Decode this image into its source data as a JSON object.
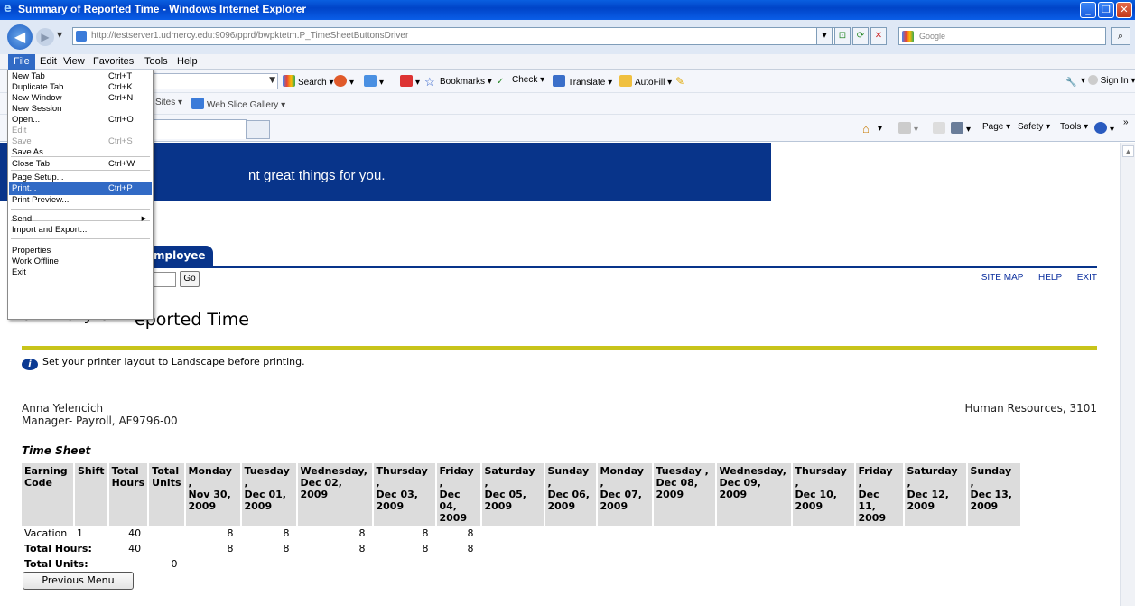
{
  "window": {
    "title": "Summary of Reported Time - Windows Internet Explorer",
    "url": "http://testserver1.udmercy.edu:9096/pprd/bwpktetm.P_TimeSheetButtonsDriver",
    "search_placeholder": "Google"
  },
  "menubar": {
    "items": [
      "File",
      "Edit",
      "View",
      "Favorites",
      "Tools",
      "Help"
    ]
  },
  "toolbar": {
    "search": "Search",
    "bookmarks": "Bookmarks",
    "check": "Check",
    "translate": "Translate",
    "autofill": "AutoFill",
    "sign_in": "Sign In",
    "favorites_partial": "Sites",
    "web_slice_gallery": "Web Slice Gallery",
    "page": "Page",
    "safety": "Safety",
    "tools": "Tools"
  },
  "file_menu": {
    "items": [
      {
        "label": "New Tab",
        "shortcut": "Ctrl+T"
      },
      {
        "label": "Duplicate Tab",
        "shortcut": "Ctrl+K"
      },
      {
        "label": "New Window",
        "shortcut": "Ctrl+N"
      },
      {
        "label": "New Session",
        "shortcut": ""
      },
      {
        "label": "Open...",
        "shortcut": "Ctrl+O"
      },
      {
        "label": "Edit",
        "shortcut": ""
      },
      {
        "label": "Save",
        "shortcut": "Ctrl+S"
      },
      {
        "label": "Save As...",
        "shortcut": ""
      },
      {
        "label": "Close Tab",
        "shortcut": "Ctrl+W"
      },
      {
        "label": "Page Setup...",
        "shortcut": ""
      },
      {
        "label": "Print...",
        "shortcut": "Ctrl+P"
      },
      {
        "label": "Print Preview...",
        "shortcut": ""
      },
      {
        "label": "Send",
        "shortcut": ""
      },
      {
        "label": "Import and Export...",
        "shortcut": ""
      },
      {
        "label": "Properties",
        "shortcut": ""
      },
      {
        "label": "Work Offline",
        "shortcut": ""
      },
      {
        "label": "Exit",
        "shortcut": ""
      }
    ]
  },
  "page": {
    "banner_slogan": "nt great things for you.",
    "employee_tab": "mployee",
    "go_label": "Go",
    "links": {
      "site_map": "SITE MAP",
      "help": "HELP",
      "exit": "EXIT"
    },
    "title": "Summary of Reported Time",
    "title_visible": "eported Time",
    "title_partial": "ummary of",
    "info_text": "Set your printer layout to Landscape before printing.",
    "employee_name": "Anna Yelencich",
    "employee_position": "Manager- Payroll, AF9796-00",
    "department": "Human Resources, 3101",
    "timesheet_title": "Time Sheet",
    "previous_menu": "Previous Menu"
  },
  "timesheet": {
    "headers": [
      [
        "Earning",
        "Code"
      ],
      [
        "Shift"
      ],
      [
        "Total",
        "Hours"
      ],
      [
        "Total",
        "Units"
      ],
      [
        "Monday ,",
        "Nov 30,",
        "2009"
      ],
      [
        "Tuesday ,",
        "Dec 01,",
        "2009"
      ],
      [
        "Wednesday,",
        "Dec 02,",
        "2009"
      ],
      [
        "Thursday ,",
        "Dec 03,",
        "2009"
      ],
      [
        "Friday ,",
        "Dec 04,",
        "2009"
      ],
      [
        "Saturday ,",
        "Dec 05,",
        "2009"
      ],
      [
        "Sunday ,",
        "Dec 06,",
        "2009"
      ],
      [
        "Monday ,",
        "Dec 07,",
        "2009"
      ],
      [
        "Tuesday ,",
        "Dec 08,",
        "2009"
      ],
      [
        "Wednesday,",
        "Dec 09,",
        "2009"
      ],
      [
        "Thursday ,",
        "Dec 10,",
        "2009"
      ],
      [
        "Friday ,",
        "Dec 11,",
        "2009"
      ],
      [
        "Saturday ,",
        "Dec 12,",
        "2009"
      ],
      [
        "Sunday ,",
        "Dec 13,",
        "2009"
      ]
    ],
    "rows": [
      {
        "code": "Vacation",
        "shift": "1",
        "total_hours": "40",
        "total_units": "",
        "days": [
          "8",
          "8",
          "8",
          "8",
          "8",
          "",
          "",
          "",
          "",
          "",
          "",
          "",
          "",
          ""
        ]
      },
      {
        "code": "Total Hours:",
        "shift": "",
        "total_hours": "40",
        "total_units": "",
        "days": [
          "8",
          "8",
          "8",
          "8",
          "8",
          "",
          "",
          "",
          "",
          "",
          "",
          "",
          "",
          ""
        ]
      },
      {
        "code": "Total Units:",
        "shift": "",
        "total_hours": "",
        "total_units": "0",
        "days": [
          "",
          "",
          "",
          "",
          "",
          "",
          "",
          "",
          "",
          "",
          "",
          "",
          "",
          ""
        ]
      }
    ]
  },
  "colors": {
    "banner": "#08348a",
    "rule": "#c8c41a",
    "menu_highlight": "#316ac5",
    "header_bg": "#dcdcdc"
  }
}
